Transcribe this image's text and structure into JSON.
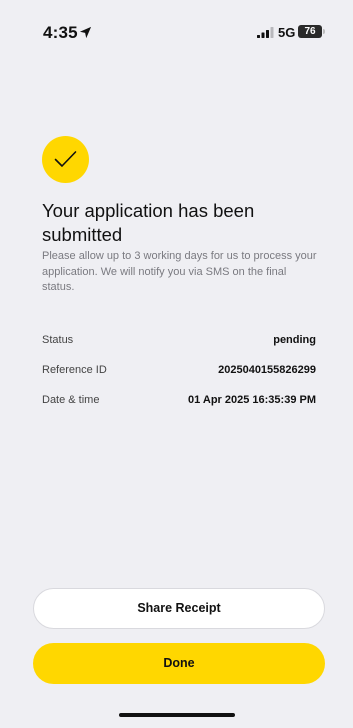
{
  "status_bar": {
    "time": "4:35",
    "network": "5G",
    "battery": "76",
    "icons": [
      "location-arrow-icon",
      "signal-icon"
    ]
  },
  "success": {
    "icon": "checkmark-icon",
    "title": "Your application has been submitted",
    "message": "Please allow up to 3 working days for us to process your application. We will notify you via SMS on the final status."
  },
  "details": {
    "status_label": "Status",
    "status_value": "pending",
    "reference_label": "Reference ID",
    "reference_value": "2025040155826299",
    "datetime_label": "Date & time",
    "datetime_value": "01 Apr 2025 16:35:39 PM"
  },
  "actions": {
    "share_label": "Share Receipt",
    "done_label": "Done"
  },
  "colors": {
    "accent": "#ffd700",
    "background": "#efeff3",
    "muted_text": "#7a7a80"
  }
}
